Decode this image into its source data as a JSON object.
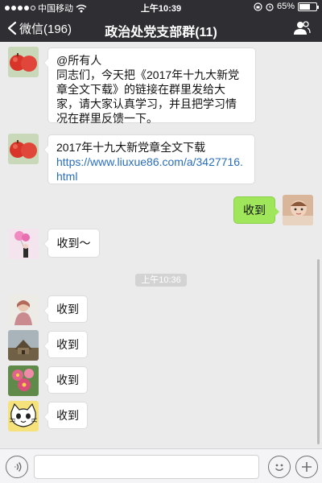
{
  "status_bar": {
    "carrier": "中国移动",
    "time": "上午10:39",
    "battery": "65%",
    "battery_level": 0.65,
    "signal_bars": 4
  },
  "nav": {
    "back_label": "微信(196)",
    "title": "政治处党支部群(11)",
    "back_icon": "chevron-left-icon",
    "contacts_icon": "group-contacts-icon"
  },
  "messages": [
    {
      "side": "left",
      "avatar": "apples-avatar",
      "text": "@所有人\n同志们，今天把《2017年十九大新党章全文下载》的链接在群里发给大家，请大家认真学习，并且把学习情况在群里反馈一下。"
    },
    {
      "side": "left",
      "avatar": "apples-avatar",
      "text": "2017年十九大新党章全文下载",
      "link": "https://www.liuxue86.com/a/3427716.html"
    },
    {
      "side": "right",
      "avatar": "child-avatar",
      "text": "收到"
    },
    {
      "side": "left",
      "avatar": "balloon-girl-avatar",
      "text": "收到～"
    },
    {
      "side": "left",
      "avatar": "woman-avatar",
      "text": "收到"
    },
    {
      "side": "left",
      "avatar": "building-avatar",
      "text": "收到"
    },
    {
      "side": "left",
      "avatar": "flowers-avatar",
      "text": "收到"
    },
    {
      "side": "left",
      "avatar": "cat-cartoon-avatar",
      "text": "收到"
    }
  ],
  "time_separator": "上午10:36",
  "input_bar": {
    "voice_icon": "voice-icon",
    "emoji_icon": "emoji-icon",
    "plus_icon": "plus-icon",
    "text_value": ""
  }
}
